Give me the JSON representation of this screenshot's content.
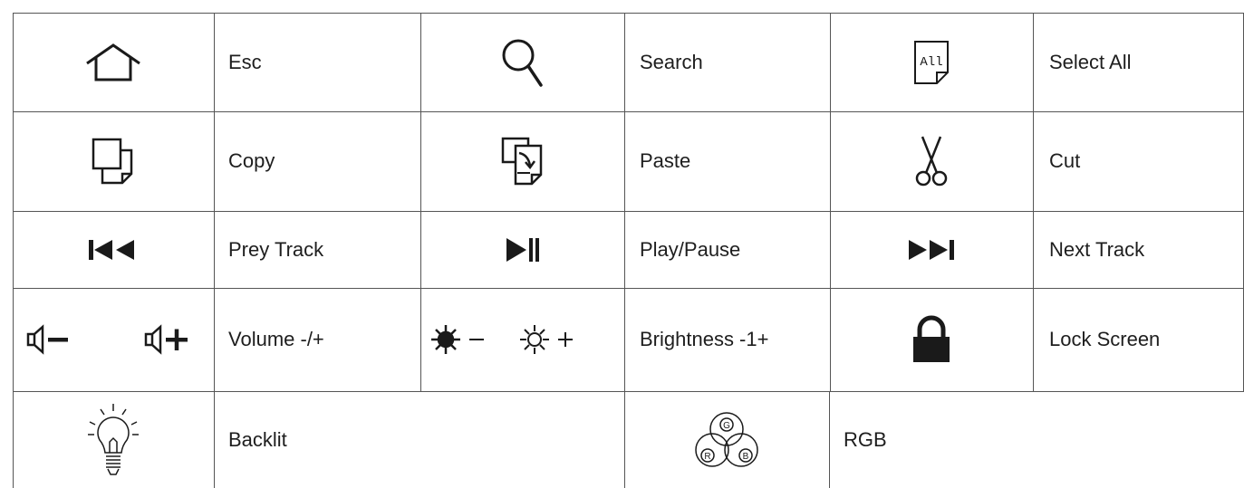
{
  "rows": [
    [
      {
        "icon": "home-icon",
        "label": "Esc"
      },
      {
        "icon": "search-icon",
        "label": "Search"
      },
      {
        "icon": "select-all-icon",
        "icon_text": "All",
        "label": "Select All"
      }
    ],
    [
      {
        "icon": "copy-icon",
        "label": "Copy"
      },
      {
        "icon": "paste-icon",
        "label": "Paste"
      },
      {
        "icon": "scissors-icon",
        "label": "Cut"
      }
    ],
    [
      {
        "icon": "previous-track-icon",
        "label": "Prey Track"
      },
      {
        "icon": "play-pause-icon",
        "label": "Play/Pause"
      },
      {
        "icon": "next-track-icon",
        "label": "Next Track"
      }
    ],
    [
      {
        "icon": "volume-down-up-icons",
        "label": "Volume -/+"
      },
      {
        "icon": "brightness-down-up-icons",
        "label": "Brightness -1+"
      },
      {
        "icon": "lock-icon",
        "label": "Lock Screen"
      }
    ]
  ],
  "last_row": [
    {
      "icon": "lightbulb-icon",
      "label": "Backlit"
    },
    {
      "icon": "rgb-circles-icon",
      "icon_letters": [
        "G",
        "R",
        "B"
      ],
      "label": "RGB"
    }
  ],
  "colors": {
    "lines": "#555555",
    "icons": "#1a1a1a",
    "text": "#1e1e1e"
  }
}
